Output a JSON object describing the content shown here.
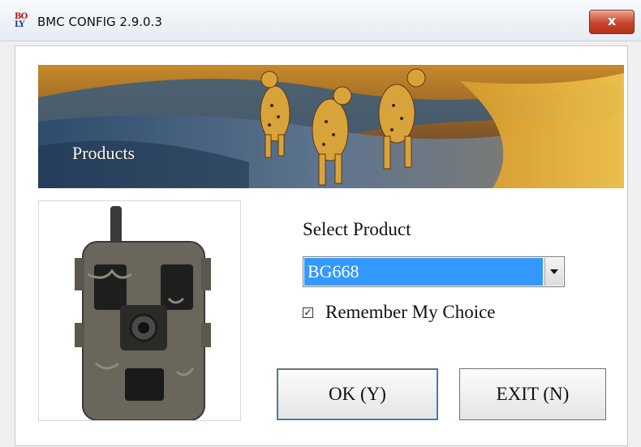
{
  "window": {
    "title": "BMC CONFIG 2.9.0.3",
    "app_icon_text_line1": "BO",
    "app_icon_text_line2": "LY",
    "close_label": "x"
  },
  "banner": {
    "label": "Products",
    "image_subject": "three cheetahs walking on a dirt road"
  },
  "product_image": {
    "subject": "trail camera in camouflage housing with antenna"
  },
  "form": {
    "select_label": "Select Product",
    "selected_product": "BG668",
    "remember_label": "Remember My Choice",
    "remember_checked": true,
    "check_mark": "✓"
  },
  "buttons": {
    "ok_label": "OK (Y)",
    "exit_label": "EXIT (N)"
  },
  "colors": {
    "selection": "#3399ff",
    "close_button": "#c8452d"
  }
}
